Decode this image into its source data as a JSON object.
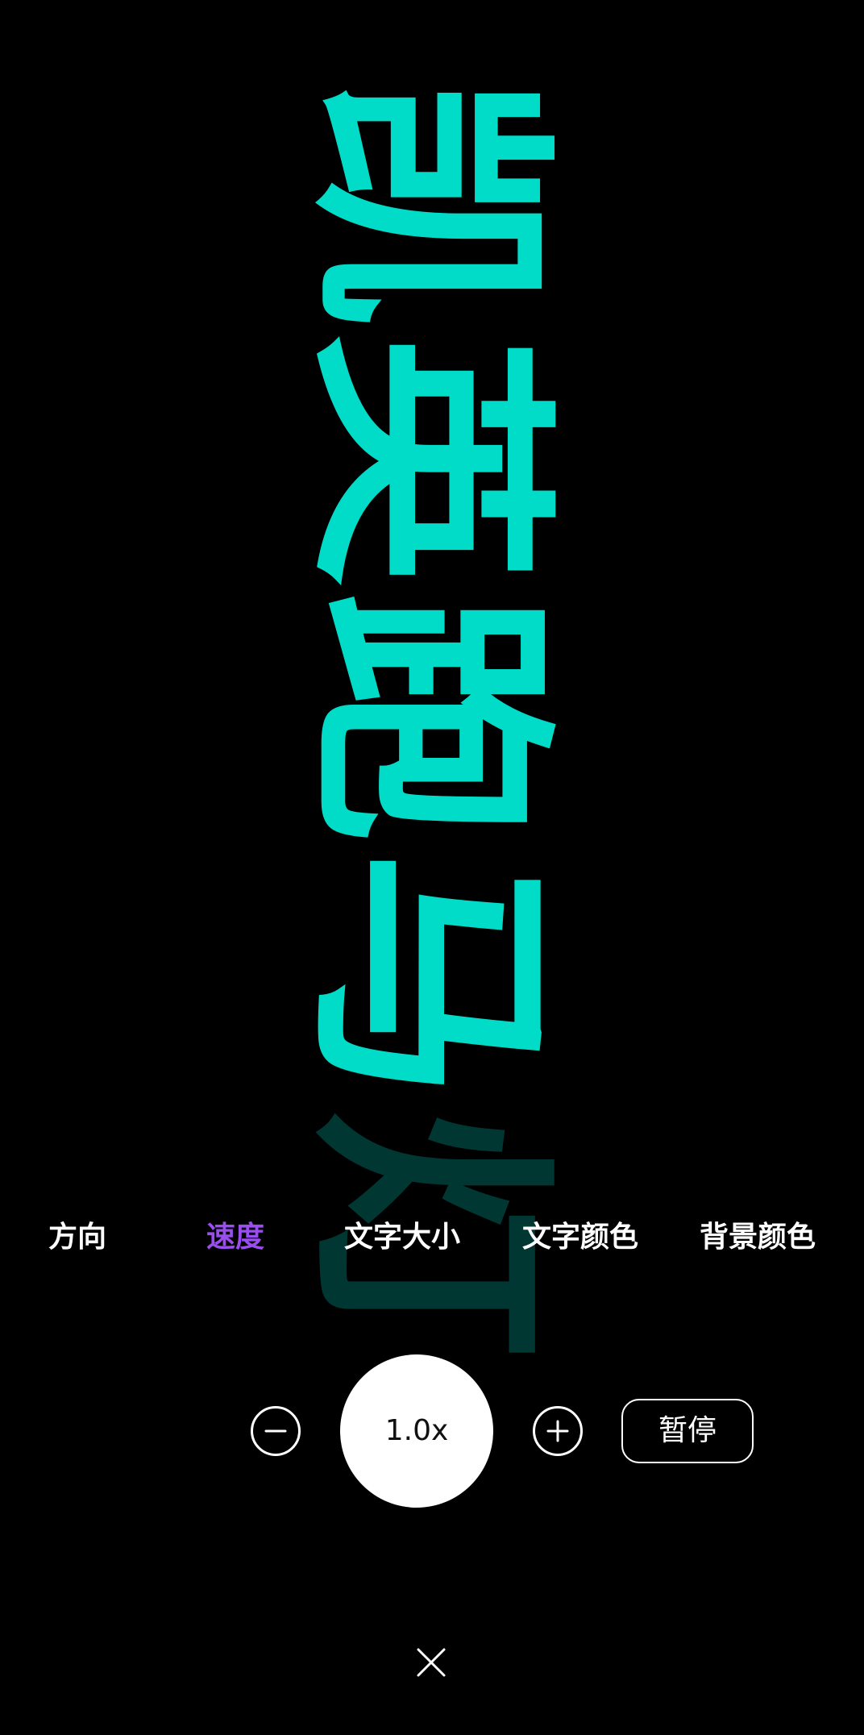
{
  "marquee": {
    "characters": [
      "凯",
      "英",
      "跑",
      "马",
      "灯"
    ],
    "color": "#00dcc8"
  },
  "tabs": [
    {
      "label": "方向",
      "active": false
    },
    {
      "label": "速度",
      "active": true
    },
    {
      "label": "文字大小",
      "active": false
    },
    {
      "label": "文字颜色",
      "active": false
    },
    {
      "label": "背景颜色",
      "active": false
    }
  ],
  "tab_active_color": "#9a4df0",
  "controls": {
    "decrease_icon": "minus-circle-icon",
    "speed_value": "1.0x",
    "increase_icon": "plus-circle-icon",
    "pause_label": "暂停"
  },
  "close_icon": "close-icon",
  "background_color": "#000000"
}
